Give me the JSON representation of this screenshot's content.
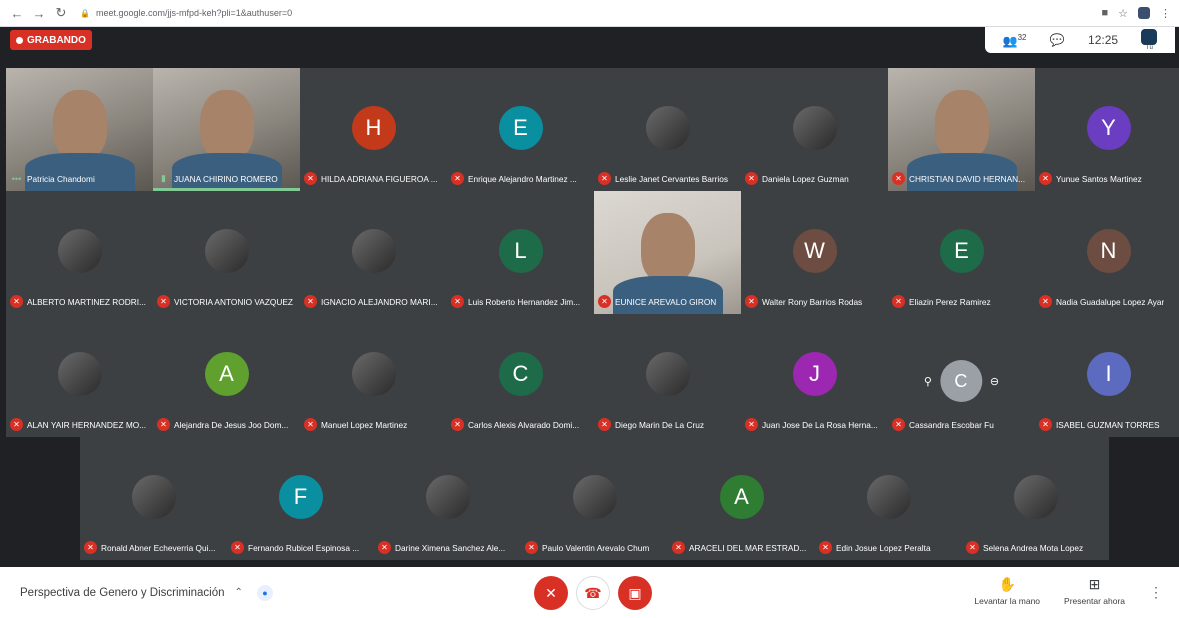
{
  "browser": {
    "url": "meet.google.com/jjs-mfpd-keh?pli=1&authuser=0"
  },
  "meet": {
    "recording_label": "GRABANDO",
    "people_count": "32",
    "time": "12:25",
    "self_label": "Tú"
  },
  "participants": [
    {
      "name": "Patricia Chandomi",
      "mode": "video",
      "mic": "speaking-dots"
    },
    {
      "name": "JUANA CHIRINO ROMERO",
      "mode": "video",
      "mic": "speaking",
      "active": true
    },
    {
      "name": "HILDA ADRIANA FIGUEROA ...",
      "mode": "avatar",
      "initial": "H",
      "color": "#c23a1a",
      "mic": "off"
    },
    {
      "name": "Enrique Alejandro Martinez ...",
      "mode": "avatar",
      "initial": "E",
      "color": "#0a8fa0",
      "mic": "off"
    },
    {
      "name": "Leslie Janet Cervantes Barrios",
      "mode": "photo",
      "mic": "off"
    },
    {
      "name": "Daniela Lopez Guzman",
      "mode": "photo",
      "mic": "off"
    },
    {
      "name": "CHRISTIAN DAVID HERNAN...",
      "mode": "video",
      "mic": "off"
    },
    {
      "name": "Yunue Santos Martinez",
      "mode": "avatar",
      "initial": "Y",
      "color": "#6a3dc1",
      "mic": "off"
    },
    {
      "name": "ALBERTO MARTINEZ RODRI...",
      "mode": "photo",
      "mic": "off"
    },
    {
      "name": "VICTORIA ANTONIO VAZQUEZ",
      "mode": "photo",
      "mic": "off"
    },
    {
      "name": "IGNACIO ALEJANDRO MARI...",
      "mode": "photo",
      "mic": "off"
    },
    {
      "name": "Luis Roberto Hernandez Jim...",
      "mode": "avatar",
      "initial": "L",
      "color": "#1e6b4a",
      "mic": "off"
    },
    {
      "name": "EUNICE AREVALO GIRON",
      "mode": "video",
      "mic": "off"
    },
    {
      "name": "Walter Rony Barrios Rodas",
      "mode": "avatar",
      "initial": "W",
      "color": "#6d4c41",
      "mic": "off"
    },
    {
      "name": "Eliazin Perez Ramirez",
      "mode": "avatar",
      "initial": "E",
      "color": "#1e6b4a",
      "mic": "off"
    },
    {
      "name": "Nadia Guadalupe Lopez Ayar",
      "mode": "avatar",
      "initial": "N",
      "color": "#6d4c41",
      "mic": "off"
    },
    {
      "name": "ALAN YAIR HERNANDEZ MO...",
      "mode": "photo",
      "mic": "off"
    },
    {
      "name": "Alejandra De Jesus Joo Dom...",
      "mode": "avatar",
      "initial": "A",
      "color": "#5fa02e",
      "mic": "off"
    },
    {
      "name": "Manuel Lopez Martinez",
      "mode": "photo",
      "mic": "off"
    },
    {
      "name": "Carlos Alexis Alvarado Domi...",
      "mode": "avatar",
      "initial": "C",
      "color": "#1e6b4a",
      "mic": "off"
    },
    {
      "name": "Diego Marin De La Cruz",
      "mode": "photo",
      "mic": "off"
    },
    {
      "name": "Juan Jose De La Rosa Herna...",
      "mode": "avatar",
      "initial": "J",
      "color": "#9c27b0",
      "mic": "off"
    },
    {
      "name": "Cassandra Escobar Fu",
      "mode": "hover",
      "initial": "C",
      "mic": "off"
    },
    {
      "name": "ISABEL GUZMAN TORRES",
      "mode": "avatar",
      "initial": "I",
      "color": "#5c6bc0",
      "mic": "off"
    },
    {
      "name": "Ronald Abner Echeverria Qui...",
      "mode": "photo",
      "mic": "off"
    },
    {
      "name": "Fernando Rubicel Espinosa ...",
      "mode": "avatar",
      "initial": "F",
      "color": "#0a8fa0",
      "mic": "off"
    },
    {
      "name": "Darine Ximena Sanchez Ale...",
      "mode": "photo",
      "mic": "off"
    },
    {
      "name": "Paulo Valentin Arevalo Chum",
      "mode": "photo",
      "mic": "off"
    },
    {
      "name": "ARACELI DEL MAR ESTRAD...",
      "mode": "avatar",
      "initial": "A",
      "color": "#2e7d32",
      "mic": "off"
    },
    {
      "name": "Edin Josue Lopez Peralta",
      "mode": "photo",
      "mic": "off"
    },
    {
      "name": "Selena Andrea Mota Lopez",
      "mode": "photo",
      "mic": "off"
    }
  ],
  "bottom": {
    "meeting_title": "Perspectiva de Genero y Discriminación",
    "raise_hand_label": "Levantar la mano",
    "present_label": "Presentar ahora"
  }
}
